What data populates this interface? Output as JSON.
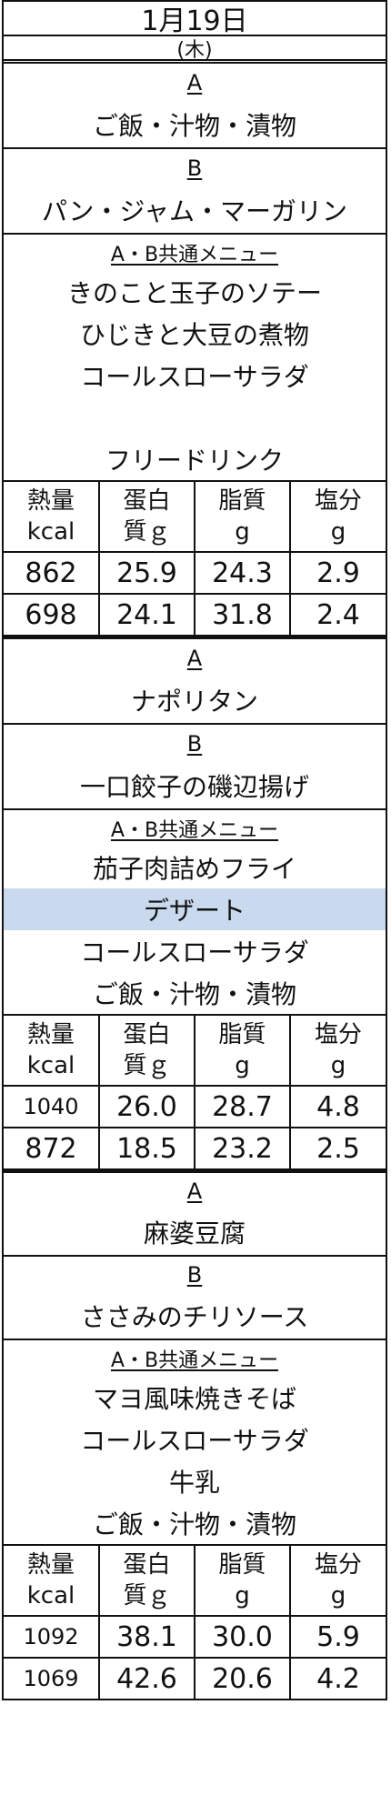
{
  "header": {
    "date": "1月19日",
    "weekday": "(木)"
  },
  "labels": {
    "a": "A",
    "b": "B",
    "common": "A・B共通メニュー"
  },
  "nutrition_headers": [
    {
      "line1": "熱量",
      "line2": "kcal"
    },
    {
      "line1": "蛋白",
      "line2": "質ｇ"
    },
    {
      "line1": "脂質",
      "line2": "g"
    },
    {
      "line1": "塩分",
      "line2": "g"
    }
  ],
  "sections": [
    {
      "a_items": [
        "ご飯・汁物・漬物"
      ],
      "b_items": [
        "パン・ジャム・マーガリン"
      ],
      "common_items": [
        "きのこと玉子のソテー",
        "ひじきと大豆の煮物",
        "コールスローサラダ",
        "",
        "フリードリンク"
      ],
      "rows": [
        [
          "862",
          "25.9",
          "24.3",
          "2.9"
        ],
        [
          "698",
          "24.1",
          "31.8",
          "2.4"
        ]
      ]
    },
    {
      "a_items": [
        "ナポリタン"
      ],
      "b_items": [
        "一口餃子の磯辺揚げ"
      ],
      "common_items": [
        "茄子肉詰めフライ",
        "デザート",
        "コールスローサラダ",
        "ご飯・汁物・漬物"
      ],
      "highlight": "デザート",
      "rows": [
        [
          "1040",
          "26.0",
          "28.7",
          "4.8"
        ],
        [
          "872",
          "18.5",
          "23.2",
          "2.5"
        ]
      ]
    },
    {
      "a_items": [
        "麻婆豆腐"
      ],
      "b_items": [
        "ささみのチリソース"
      ],
      "common_items": [
        "マヨ風味焼きそば",
        "コールスローサラダ",
        "牛乳",
        "ご飯・汁物・漬物"
      ],
      "rows": [
        [
          "1092",
          "38.1",
          "30.0",
          "5.9"
        ],
        [
          "1069",
          "42.6",
          "20.6",
          "4.2"
        ]
      ]
    }
  ],
  "colors": {
    "highlight": "#c9d9ee"
  }
}
